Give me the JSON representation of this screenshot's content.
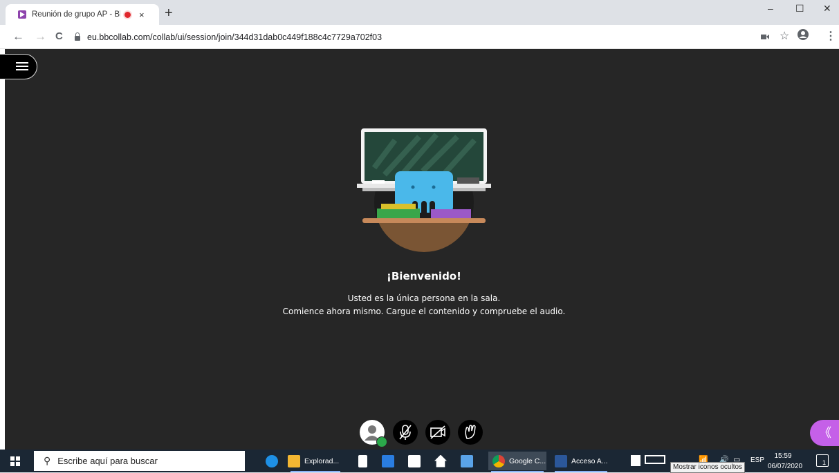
{
  "browser": {
    "tab": {
      "title": "Reunión de grupo AP - Bb C",
      "close": "×"
    },
    "new_tab": "+",
    "window_controls": {
      "minimize": "–",
      "maximize": "☐",
      "close": "✕"
    },
    "nav": {
      "back": "←",
      "forward": "→",
      "reload": "C"
    },
    "url": "eu.bbcollab.com/collab/ui/session/join/344d31dab0c449f188c4c7729a702f03",
    "toolbar_icons": [
      "camera-icon",
      "star-icon",
      "profile-icon",
      "kebab-menu-icon"
    ]
  },
  "session": {
    "welcome_title": "¡Bienvenido!",
    "line1": "Usted es la única persona en la sala.",
    "line2": "Comience ahora mismo. Cargue el contenido y compruebe el audio.",
    "controls": [
      "avatar-status",
      "microphone-off-icon",
      "camera-off-icon",
      "raise-hand-icon"
    ],
    "collab_panel_toggle": "《",
    "colors": {
      "background": "#262626",
      "accent": "#c560e8",
      "status_ok": "#2ba84a"
    }
  },
  "taskbar": {
    "search_placeholder": "Escribe aquí para buscar",
    "apps": [
      {
        "icon": "edge-icon",
        "label": ""
      },
      {
        "icon": "file-explorer-icon",
        "label": "Explorad..."
      },
      {
        "icon": "document-icon",
        "label": ""
      },
      {
        "icon": "app-icon",
        "label": ""
      },
      {
        "icon": "store-icon",
        "label": ""
      },
      {
        "icon": "home-icon",
        "label": ""
      },
      {
        "icon": "remote-desktop-icon",
        "label": ""
      },
      {
        "icon": "chrome-icon",
        "label": "Google C..."
      },
      {
        "icon": "word-icon",
        "label": "Acceso A..."
      }
    ],
    "tooltip": "Mostrar iconos ocultos",
    "language": "ESP",
    "time": "15:59",
    "date": "06/07/2020",
    "notification_count": "1"
  }
}
